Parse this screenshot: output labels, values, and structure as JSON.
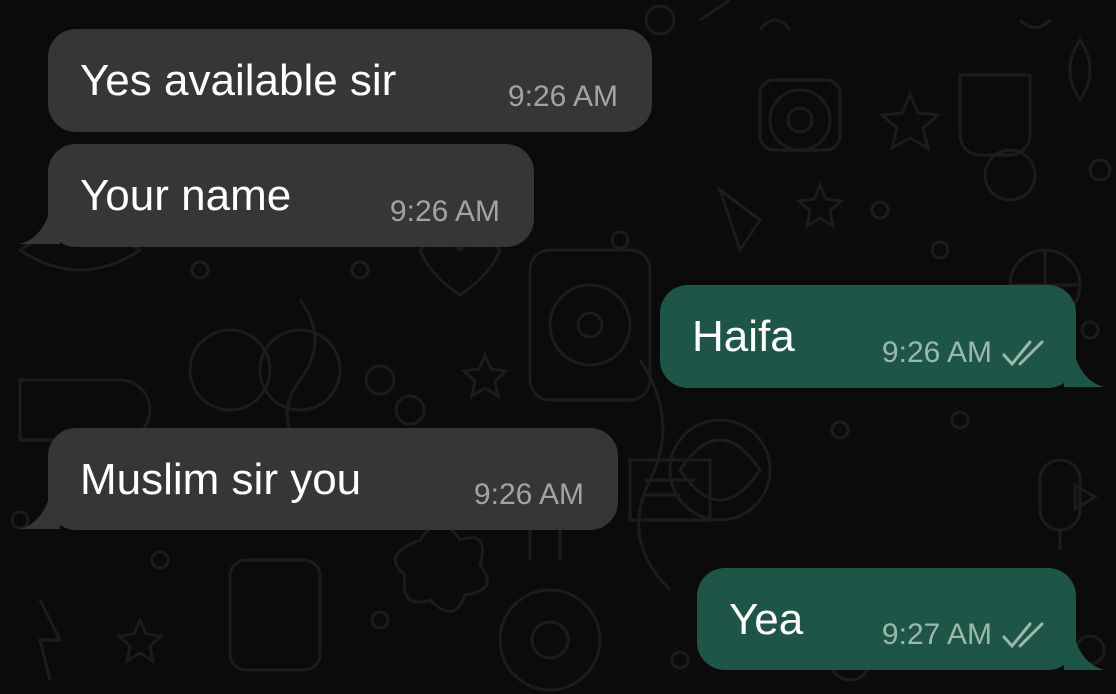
{
  "chat": {
    "colors": {
      "background": "#0b0b0b",
      "incoming_bubble": "#363638",
      "outgoing_bubble": "#1d5547",
      "timestamp": "#a3a3a6"
    },
    "messages": [
      {
        "direction": "incoming",
        "text": "Yes available sir",
        "time": "9:26 AM"
      },
      {
        "direction": "incoming",
        "text": "Your name",
        "time": "9:26 AM"
      },
      {
        "direction": "outgoing",
        "text": "Haifa",
        "time": "9:26 AM",
        "status_icon": "double-check-icon"
      },
      {
        "direction": "incoming",
        "text": "Muslim sir you",
        "time": "9:26 AM"
      },
      {
        "direction": "outgoing",
        "text": "Yea",
        "time": "9:27 AM",
        "status_icon": "double-check-icon"
      }
    ]
  }
}
